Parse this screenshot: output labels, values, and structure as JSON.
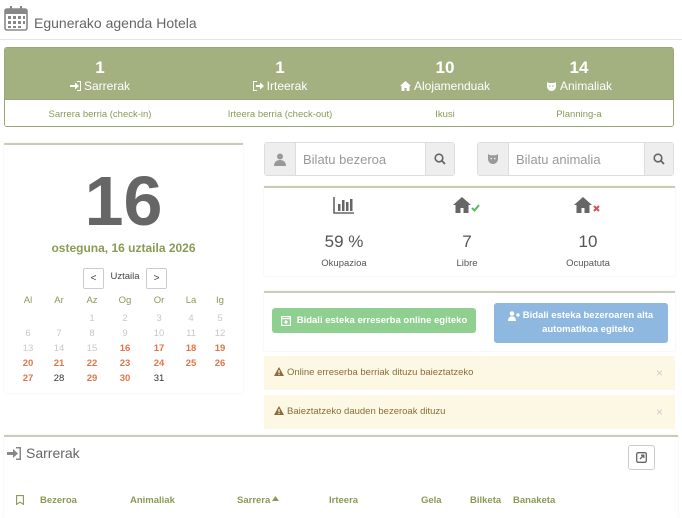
{
  "header": {
    "title": "Egunerako agenda Hotela",
    "icon": "calendar-icon"
  },
  "summary": {
    "stats": [
      {
        "value": "1",
        "label": "Sarrerak",
        "icon": "sign-in-icon"
      },
      {
        "value": "1",
        "label": "Irteerak",
        "icon": "sign-out-icon"
      },
      {
        "value": "10",
        "label": "Alojamenduak",
        "icon": "home-icon"
      },
      {
        "value": "14",
        "label": "Animaliak",
        "icon": "dog-icon"
      }
    ],
    "links": [
      "Sarrera berria (check-in)",
      "Irteera berria (check-out)",
      "Ikusi",
      "Planning-a"
    ]
  },
  "date": {
    "day": "16",
    "full": "osteguna, 16 uztaila 2026",
    "month": "Uztaila",
    "prev": "<",
    "next": ">",
    "weekdays": [
      "Al",
      "Ar",
      "Az",
      "Og",
      "Or",
      "La",
      "Ig"
    ],
    "weeks": [
      [
        "",
        "",
        "1",
        "2",
        "3",
        "4",
        "5"
      ],
      [
        "6",
        "7",
        "8",
        "9",
        "10",
        "11",
        "12"
      ],
      [
        "13",
        "14",
        "15",
        "16",
        "17",
        "18",
        "19"
      ],
      [
        "20",
        "21",
        "22",
        "23",
        "24",
        "25",
        "26"
      ],
      [
        "27",
        "28",
        "29",
        "30",
        "31",
        "",
        ""
      ]
    ]
  },
  "search": {
    "client_placeholder": "Bilatu bezeroa",
    "animal_placeholder": "Bilatu animalia"
  },
  "occupancy": [
    {
      "value": "59 %",
      "label": "Okupazioa",
      "icon": "bar-chart-icon"
    },
    {
      "value": "7",
      "label": "Libre",
      "icon": "home-check-icon"
    },
    {
      "value": "10",
      "label": "Ocupatuta",
      "icon": "home-cross-icon"
    }
  ],
  "actions": {
    "green_button": "Bidali esteka erreserba online egiteko",
    "blue_button": "Bidali esteka bezeroaren alta automatikoa egiteko"
  },
  "alerts": [
    "Online erreserba berriak dituzu baieztatzeko",
    "Baieztatzeko dauden bezeroak dituzu"
  ],
  "sarrerak": {
    "title": "Sarrerak",
    "columns": [
      "Bezeroa",
      "Animaliak",
      "Sarrera",
      "Irteera",
      "Gela",
      "Bilketa",
      "Banaketa"
    ]
  },
  "colors": {
    "accent": "#a3b080",
    "link": "#8a9a55",
    "weekend": "#e2754a",
    "green_button": "#8fcf8f",
    "blue_button": "#8eb8df",
    "alert_bg": "#fcf8e3"
  }
}
